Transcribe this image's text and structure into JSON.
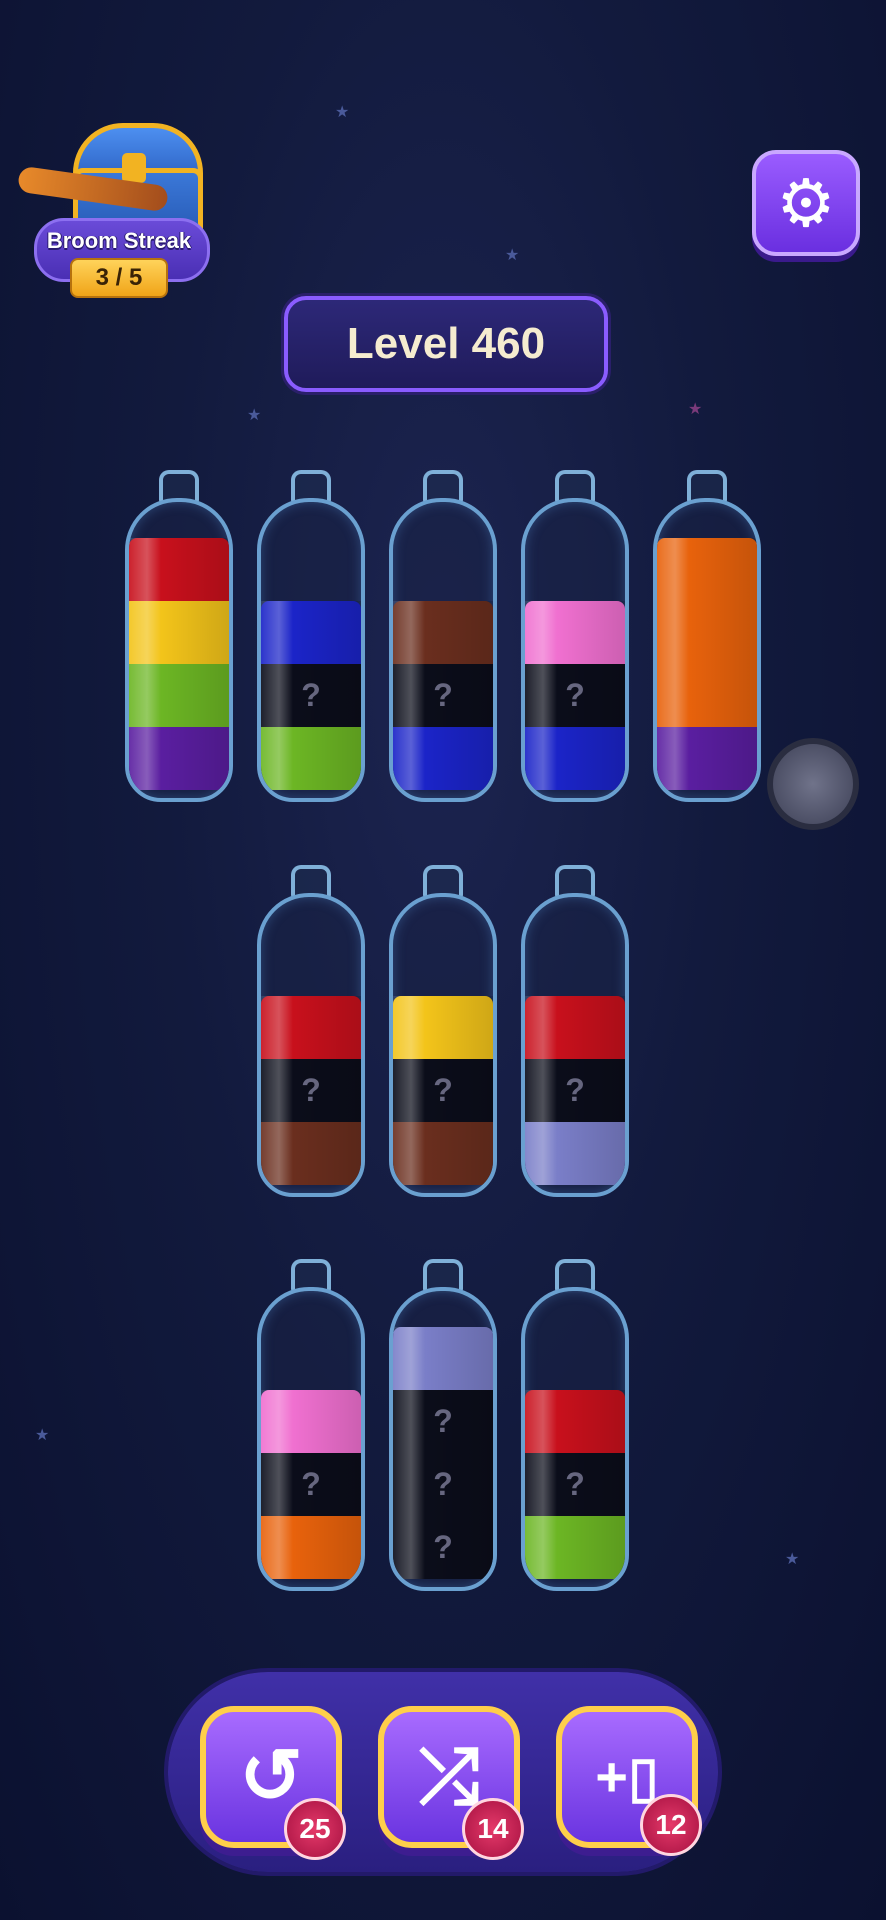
{
  "streak": {
    "label": "Broom Streak",
    "count": "3 / 5"
  },
  "level": {
    "title": "Level 460"
  },
  "icons": {
    "settings": "gear-icon",
    "undo": "undo-icon",
    "shuffle": "shuffle-icon",
    "add_bottle": "add-bottle-icon"
  },
  "colors": {
    "red": "#c8101c",
    "yellow": "#f3c41a",
    "green": "#6cb624",
    "purple": "#5a1ea0",
    "blue": "#1b24c8",
    "brown": "#6a2e1e",
    "pink": "#f070d0",
    "orange": "#e8620c",
    "hidden": "#0b0d1a",
    "lavender": "#7a7ec8"
  },
  "hidden_mark": "?",
  "bottles": [
    {
      "layers": [
        "red",
        "yellow",
        "green",
        "purple"
      ]
    },
    {
      "layers": [
        "blue",
        "hidden",
        "green"
      ]
    },
    {
      "layers": [
        "brown",
        "hidden",
        "blue"
      ]
    },
    {
      "layers": [
        "pink",
        "hidden",
        "blue"
      ]
    },
    {
      "layers": [
        "orange",
        "orange",
        "orange",
        "purple"
      ]
    },
    {
      "layers": [
        "red",
        "hidden",
        "brown"
      ]
    },
    {
      "layers": [
        "yellow",
        "hidden",
        "brown"
      ]
    },
    {
      "layers": [
        "red",
        "hidden",
        "lavender"
      ]
    },
    {
      "layers": [
        "pink",
        "hidden",
        "orange"
      ]
    },
    {
      "layers": [
        "lavender",
        "hidden",
        "hidden",
        "hidden"
      ]
    },
    {
      "layers": [
        "red",
        "hidden",
        "green"
      ]
    }
  ],
  "boosters": {
    "undo": {
      "count": "25"
    },
    "shuffle": {
      "count": "14"
    },
    "add_bottle": {
      "count": "12"
    }
  }
}
